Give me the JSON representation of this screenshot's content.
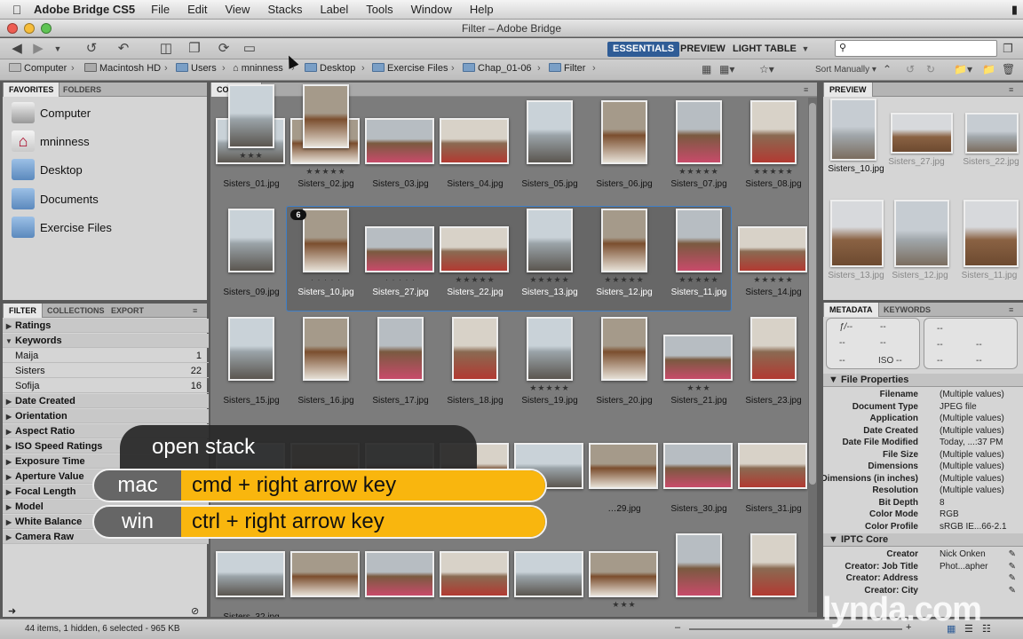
{
  "menubar": {
    "app": "Adobe Bridge CS5",
    "items": [
      "File",
      "Edit",
      "View",
      "Stacks",
      "Label",
      "Tools",
      "Window",
      "Help"
    ]
  },
  "window": {
    "title": "Filter – Adobe Bridge"
  },
  "workspaces": [
    "ESSENTIALS",
    "PREVIEW",
    "LIGHT TABLE"
  ],
  "search": {
    "placeholder": ""
  },
  "path": [
    "Computer",
    "Macintosh HD",
    "Users",
    "mninness",
    "Desktop",
    "Exercise Files",
    "Chap_01-06",
    "Filter"
  ],
  "sort": "Sort Manually",
  "favorites": {
    "tabs": [
      "FAVORITES",
      "FOLDERS"
    ],
    "items": [
      "Computer",
      "mninness",
      "Desktop",
      "Documents",
      "Exercise Files"
    ]
  },
  "filter": {
    "tabs": [
      "FILTER",
      "COLLECTIONS",
      "EXPORT"
    ],
    "rows": [
      {
        "label": "Ratings",
        "type": "h",
        "open": false
      },
      {
        "label": "Keywords",
        "type": "h",
        "open": true
      },
      {
        "label": "Maija",
        "type": "i",
        "count": "1"
      },
      {
        "label": "Sisters",
        "type": "i",
        "count": "22"
      },
      {
        "label": "Sofija",
        "type": "i",
        "count": "16"
      },
      {
        "label": "Date Created",
        "type": "h",
        "open": false
      },
      {
        "label": "Orientation",
        "type": "h",
        "open": false
      },
      {
        "label": "Aspect Ratio",
        "type": "h",
        "open": false
      },
      {
        "label": "ISO Speed Ratings",
        "type": "h",
        "open": false
      },
      {
        "label": "Exposure Time",
        "type": "h",
        "open": false
      },
      {
        "label": "Aperture Value",
        "type": "h",
        "open": false
      },
      {
        "label": "Focal Length",
        "type": "h",
        "open": false
      },
      {
        "label": "Model",
        "type": "h",
        "open": false
      },
      {
        "label": "White Balance",
        "type": "h",
        "open": false
      },
      {
        "label": "Camera Raw",
        "type": "h",
        "open": false
      }
    ]
  },
  "content": {
    "tab": "CONTENT",
    "stack_count": "6",
    "thumbs": [
      {
        "name": "Sisters_01.jpg",
        "stars": "",
        "o": "L",
        "sel": false
      },
      {
        "name": "Sisters_02.jpg",
        "stars": "★★★★★",
        "o": "L",
        "sel": false
      },
      {
        "name": "Sisters_03.jpg",
        "stars": "",
        "o": "L",
        "sel": false
      },
      {
        "name": "Sisters_04.jpg",
        "stars": "",
        "o": "L",
        "sel": false
      },
      {
        "name": "Sisters_05.jpg",
        "stars": "",
        "o": "P",
        "sel": false
      },
      {
        "name": "Sisters_06.jpg",
        "stars": "",
        "o": "P",
        "sel": false
      },
      {
        "name": "Sisters_07.jpg",
        "stars": "★★★★★",
        "o": "P",
        "sel": false
      },
      {
        "name": "Sisters_08.jpg",
        "stars": "★★★★★",
        "o": "P",
        "sel": false
      },
      {
        "name": "Sisters_09.jpg",
        "stars": "",
        "o": "P",
        "sel": false
      },
      {
        "name": "Sisters_10.jpg",
        "stars": "· · · · ·",
        "o": "P",
        "sel": true
      },
      {
        "name": "Sisters_27.jpg",
        "stars": "· · · · ·",
        "o": "L",
        "sel": true
      },
      {
        "name": "Sisters_22.jpg",
        "stars": "★★★★★",
        "o": "L",
        "sel": true
      },
      {
        "name": "Sisters_13.jpg",
        "stars": "★★★★★",
        "o": "P",
        "sel": true
      },
      {
        "name": "Sisters_12.jpg",
        "stars": "★★★★★",
        "o": "P",
        "sel": true
      },
      {
        "name": "Sisters_11.jpg",
        "stars": "★★★★★",
        "o": "P",
        "sel": true
      },
      {
        "name": "Sisters_14.jpg",
        "stars": "★★★★★",
        "o": "L",
        "sel": false
      },
      {
        "name": "Sisters_15.jpg",
        "stars": "",
        "o": "P",
        "sel": false
      },
      {
        "name": "Sisters_16.jpg",
        "stars": "",
        "o": "P",
        "sel": false
      },
      {
        "name": "Sisters_17.jpg",
        "stars": "",
        "o": "P",
        "sel": false
      },
      {
        "name": "Sisters_18.jpg",
        "stars": "",
        "o": "P",
        "sel": false
      },
      {
        "name": "Sisters_19.jpg",
        "stars": "★★★★★",
        "o": "P",
        "sel": false
      },
      {
        "name": "Sisters_20.jpg",
        "stars": "",
        "o": "P",
        "sel": false
      },
      {
        "name": "Sisters_21.jpg",
        "stars": "★★★",
        "o": "L",
        "sel": false
      },
      {
        "name": "Sisters_23.jpg",
        "stars": "",
        "o": "P",
        "sel": false
      },
      {
        "name": "",
        "stars": "",
        "o": "L",
        "sel": false
      },
      {
        "name": "",
        "stars": "",
        "o": "L",
        "sel": false
      },
      {
        "name": "",
        "stars": "",
        "o": "L",
        "sel": false
      },
      {
        "name": "",
        "stars": "",
        "o": "L",
        "sel": false
      },
      {
        "name": "",
        "stars": "",
        "o": "L",
        "sel": false
      },
      {
        "name": "…29.jpg",
        "stars": "",
        "o": "L",
        "sel": false
      },
      {
        "name": "Sisters_30.jpg",
        "stars": "",
        "o": "L",
        "sel": false
      },
      {
        "name": "Sisters_31.jpg",
        "stars": "",
        "o": "L",
        "sel": false
      },
      {
        "name": "Sisters_32.jpg",
        "stars": "",
        "o": "L",
        "sel": false
      },
      {
        "name": "",
        "stars": "",
        "o": "L",
        "sel": false
      },
      {
        "name": "",
        "stars": "",
        "o": "L",
        "sel": false
      },
      {
        "name": "",
        "stars": "",
        "o": "L",
        "sel": false
      },
      {
        "name": "",
        "stars": "",
        "o": "L",
        "sel": false
      },
      {
        "name": "",
        "stars": "★★★",
        "o": "L",
        "sel": false
      },
      {
        "name": "",
        "stars": "",
        "o": "P",
        "sel": false
      },
      {
        "name": "",
        "stars": "",
        "o": "P",
        "sel": false
      },
      {
        "name": "",
        "stars": "★★★",
        "o": "P",
        "sel": false
      },
      {
        "name": "",
        "stars": "",
        "o": "P",
        "sel": false
      }
    ]
  },
  "preview": {
    "tab": "PREVIEW",
    "items": [
      "Sisters_10.jpg",
      "Sisters_27.jpg",
      "Sisters_22.jpg",
      "Sisters_13.jpg",
      "Sisters_12.jpg",
      "Sisters_11.jpg"
    ]
  },
  "metadata": {
    "tabs": [
      "METADATA",
      "KEYWORDS"
    ],
    "camera": {
      "aperture": "ƒ/--",
      "shutter": "--",
      "dash": "--",
      "iso": "ISO --"
    },
    "file_section": "File Properties",
    "file": [
      {
        "k": "Filename",
        "v": "(Multiple values)"
      },
      {
        "k": "Document Type",
        "v": "JPEG file"
      },
      {
        "k": "Application",
        "v": "(Multiple values)"
      },
      {
        "k": "Date Created",
        "v": "(Multiple values)"
      },
      {
        "k": "Date File Modified",
        "v": "Today, ...:37 PM"
      },
      {
        "k": "File Size",
        "v": "(Multiple values)"
      },
      {
        "k": "Dimensions",
        "v": "(Multiple values)"
      },
      {
        "k": "Dimensions (in inches)",
        "v": "(Multiple values)"
      },
      {
        "k": "Resolution",
        "v": "(Multiple values)"
      },
      {
        "k": "Bit Depth",
        "v": "8"
      },
      {
        "k": "Color Mode",
        "v": "RGB"
      },
      {
        "k": "Color Profile",
        "v": "sRGB IE...66-2.1"
      }
    ],
    "iptc_section": "IPTC Core",
    "iptc": [
      {
        "k": "Creator",
        "v": "Nick Onken"
      },
      {
        "k": "Creator: Job Title",
        "v": "Phot...apher"
      },
      {
        "k": "Creator: Address",
        "v": ""
      },
      {
        "k": "Creator: City",
        "v": ""
      }
    ]
  },
  "status": "44 items, 1 hidden, 6 selected - 965 KB",
  "overlay": {
    "title": "open stack",
    "rows": [
      {
        "os": "mac",
        "combo": "cmd + right arrow key"
      },
      {
        "os": "win",
        "combo": "ctrl + right arrow key"
      }
    ]
  },
  "watermark": "lynda.com",
  "colors": {
    "accent": "#2f5c96",
    "selection": "#3f7fc8",
    "key_yellow": "#f9b60e"
  }
}
